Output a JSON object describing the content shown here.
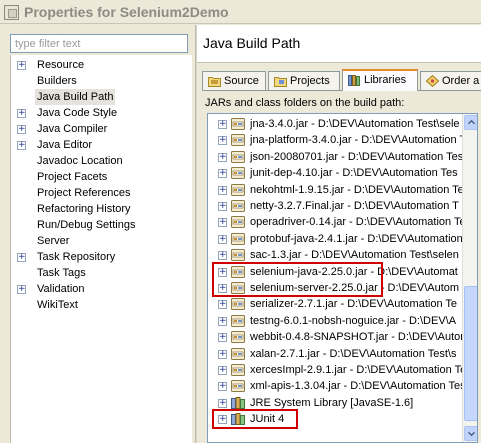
{
  "window": {
    "title": "Properties for Selenium2Demo"
  },
  "filter": {
    "placeholder": "type filter text"
  },
  "nav": [
    {
      "label": "Resource",
      "expandable": true
    },
    {
      "label": "Builders",
      "expandable": false
    },
    {
      "label": "Java Build Path",
      "expandable": false,
      "selected": true
    },
    {
      "label": "Java Code Style",
      "expandable": true
    },
    {
      "label": "Java Compiler",
      "expandable": true
    },
    {
      "label": "Java Editor",
      "expandable": true
    },
    {
      "label": "Javadoc Location",
      "expandable": false
    },
    {
      "label": "Project Facets",
      "expandable": false
    },
    {
      "label": "Project References",
      "expandable": false
    },
    {
      "label": "Refactoring History",
      "expandable": false
    },
    {
      "label": "Run/Debug Settings",
      "expandable": false
    },
    {
      "label": "Server",
      "expandable": false
    },
    {
      "label": "Task Repository",
      "expandable": true
    },
    {
      "label": "Task Tags",
      "expandable": false
    },
    {
      "label": "Validation",
      "expandable": true
    },
    {
      "label": "WikiText",
      "expandable": false
    }
  ],
  "page": {
    "title": "Java Build Path"
  },
  "tabs": [
    {
      "label": "Source",
      "icon": "source-folder-icon"
    },
    {
      "label": "Projects",
      "icon": "projects-icon"
    },
    {
      "label": "Libraries",
      "icon": "libraries-icon",
      "active": true
    },
    {
      "label": "Order a",
      "icon": "order-export-icon"
    }
  ],
  "panel_label": "JARs and class folders on the build path:",
  "entries": [
    {
      "label": "jna-3.4.0.jar - D:\\DEV\\Automation Test\\sele",
      "icon": "jar-icon"
    },
    {
      "label": "jna-platform-3.4.0.jar - D:\\DEV\\Automation Te",
      "icon": "jar-icon"
    },
    {
      "label": "json-20080701.jar - D:\\DEV\\Automation Tes",
      "icon": "jar-icon"
    },
    {
      "label": "junit-dep-4.10.jar - D:\\DEV\\Automation Tes",
      "icon": "jar-icon"
    },
    {
      "label": "nekohtml-1.9.15.jar - D:\\DEV\\Automation Te",
      "icon": "jar-icon"
    },
    {
      "label": "netty-3.2.7.Final.jar - D:\\DEV\\Automation T",
      "icon": "jar-icon"
    },
    {
      "label": "operadriver-0.14.jar - D:\\DEV\\Automation Te",
      "icon": "jar-icon"
    },
    {
      "label": "protobuf-java-2.4.1.jar - D:\\DEV\\Automation",
      "icon": "jar-icon"
    },
    {
      "label": "sac-1.3.jar - D:\\DEV\\Automation Test\\selen",
      "icon": "jar-icon"
    },
    {
      "label": "selenium-java-2.25.0.jar - D:\\DEV\\Automat",
      "icon": "jar-icon",
      "highlighted": true
    },
    {
      "label": "selenium-server-2.25.0.jar - D:\\DEV\\Autom",
      "icon": "jar-icon",
      "highlighted": true
    },
    {
      "label": "serializer-2.7.1.jar - D:\\DEV\\Automation Te",
      "icon": "jar-icon"
    },
    {
      "label": "testng-6.0.1-nobsh-noguice.jar - D:\\DEV\\A",
      "icon": "jar-icon"
    },
    {
      "label": "webbit-0.4.8-SNAPSHOT.jar - D:\\DEV\\Autom",
      "icon": "jar-icon"
    },
    {
      "label": "xalan-2.7.1.jar - D:\\DEV\\Automation Test\\s",
      "icon": "jar-icon"
    },
    {
      "label": "xercesImpl-2.9.1.jar - D:\\DEV\\Automation Te",
      "icon": "jar-icon"
    },
    {
      "label": "xml-apis-1.3.04.jar - D:\\DEV\\Automation Tes",
      "icon": "jar-icon"
    },
    {
      "label": "JRE System Library [JavaSE-1.6]",
      "icon": "library-icon"
    },
    {
      "label": "JUnit 4",
      "icon": "library-icon",
      "highlighted": true
    }
  ],
  "colors": {
    "highlight": "#d10000",
    "active_tab_accent": "#e68b2c"
  }
}
